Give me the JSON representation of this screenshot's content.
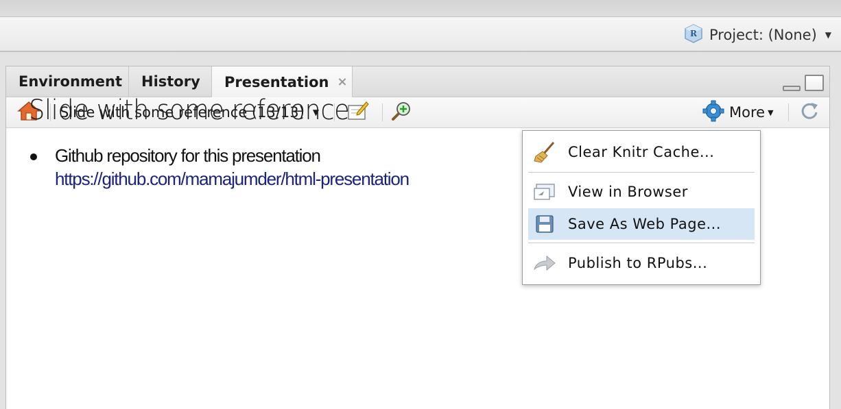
{
  "header": {
    "project_label": "Project: (None)"
  },
  "tabs": [
    {
      "label": "Environment",
      "active": false
    },
    {
      "label": "History",
      "active": false
    },
    {
      "label": "Presentation",
      "active": true,
      "close_symbol": "×"
    }
  ],
  "toolbar": {
    "slide_selector": "Slide with some reference (13/13)",
    "more_label": "More",
    "icons": [
      "home-icon",
      "edit-icon",
      "zoom-icon",
      "gear-icon",
      "refresh-icon"
    ]
  },
  "slide": {
    "title": "Slide with some reference",
    "bullet_text": "Github repository for this presentation",
    "bullet_link": "https://github.com/mamajumder/html-presentation"
  },
  "more_menu": {
    "items": [
      {
        "label": "Clear Knitr Cache...",
        "icon": "broom-icon",
        "selected": false
      },
      {
        "label": "View in Browser",
        "icon": "browser-icon",
        "selected": false
      },
      {
        "label": "Save As Web Page...",
        "icon": "save-icon",
        "selected": true
      },
      {
        "label": "Publish to RPubs...",
        "icon": "publish-arrow-icon",
        "selected": false
      }
    ]
  },
  "colors": {
    "link": "#1b237e",
    "menu_highlight": "#d6e6f5",
    "gear_blue": "#3a8ed4"
  }
}
